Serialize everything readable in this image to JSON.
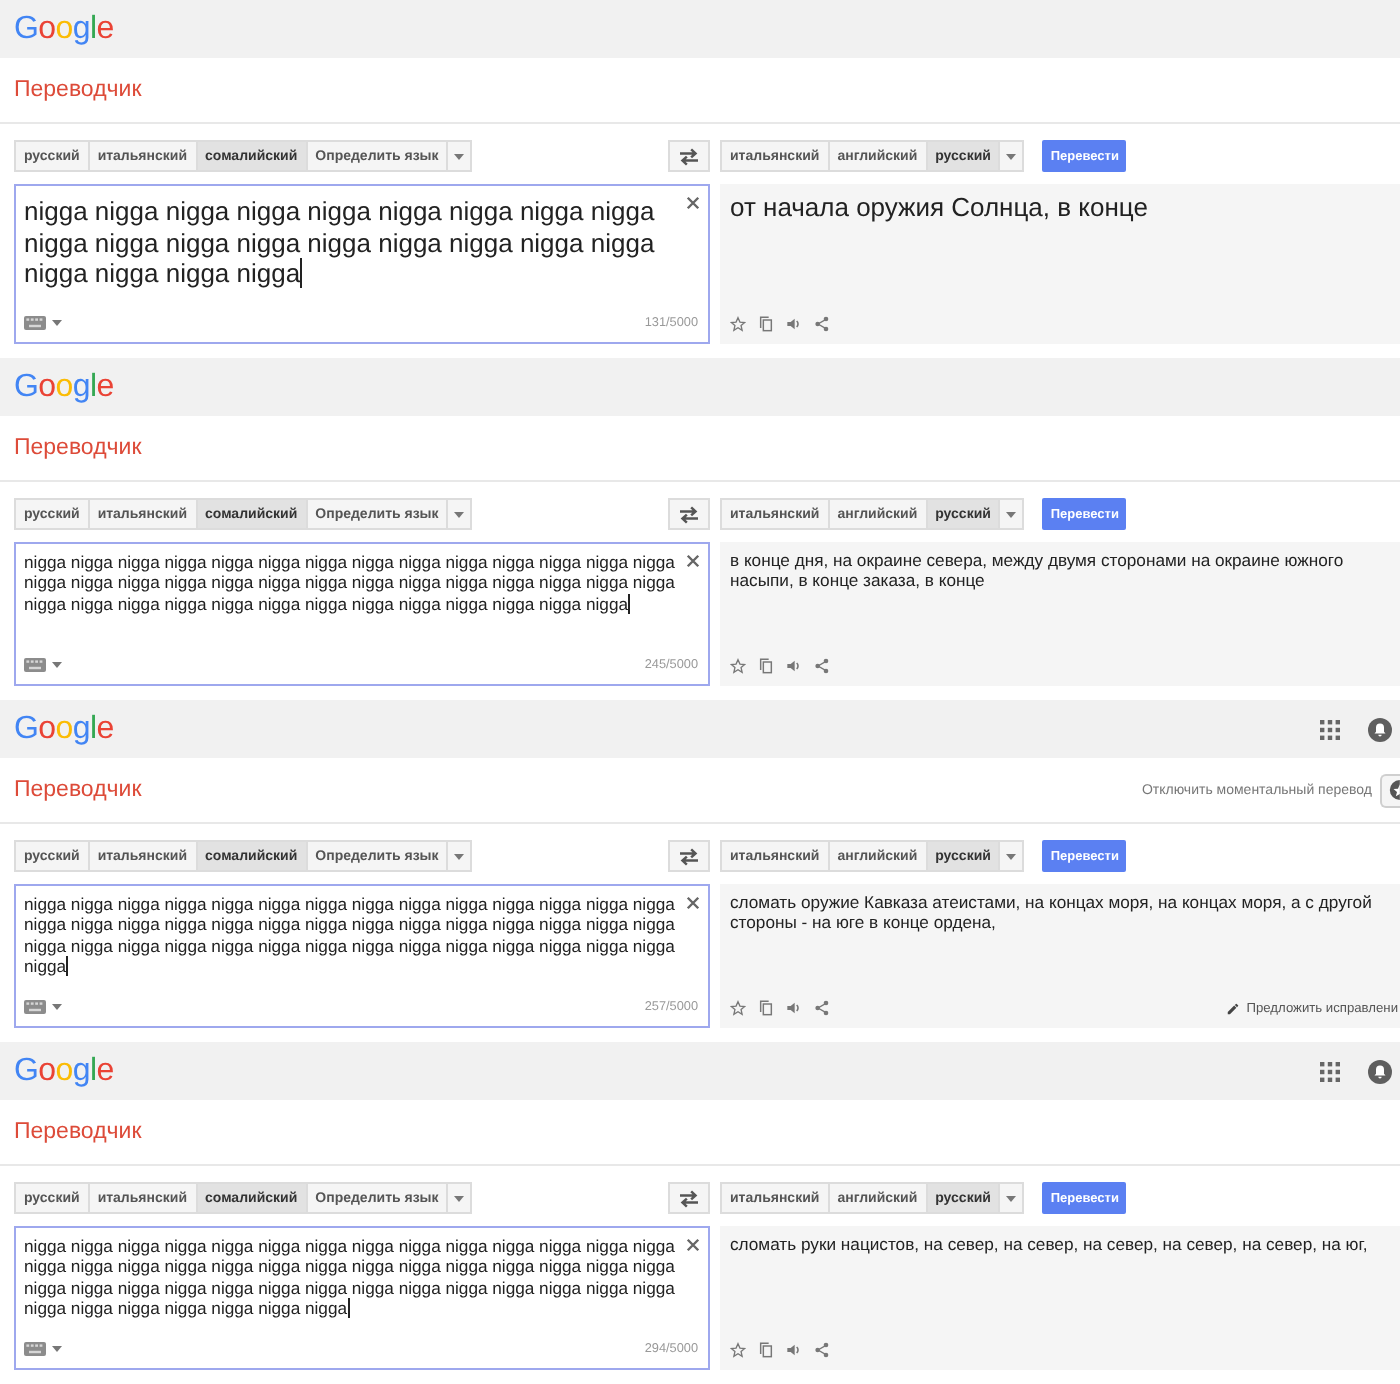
{
  "panels": [
    {
      "logo": "Google",
      "title": "Переводчик",
      "source_languages": [
        {
          "label": "русский",
          "selected": false
        },
        {
          "label": "итальянский",
          "selected": false
        },
        {
          "label": "сомалийский",
          "selected": true
        },
        {
          "label": "Определить язык",
          "selected": false
        }
      ],
      "target_languages": [
        {
          "label": "итальянский",
          "selected": false
        },
        {
          "label": "английский",
          "selected": false
        },
        {
          "label": "русский",
          "selected": true
        }
      ],
      "translate_button": "Перевести",
      "focused": true,
      "source_text": "nigga nigga nigga nigga nigga nigga nigga nigga nigga nigga nigga nigga nigga nigga nigga nigga nigga nigga nigga nigga nigga nigga",
      "char_count": "131/5000",
      "translation": "от начала оружия Солнца, в конце"
    },
    {
      "logo": "Google",
      "title": "Переводчик",
      "source_languages": [
        {
          "label": "русский",
          "selected": false
        },
        {
          "label": "итальянский",
          "selected": false
        },
        {
          "label": "сомалийский",
          "selected": true
        },
        {
          "label": "Определить язык",
          "selected": false
        }
      ],
      "target_languages": [
        {
          "label": "итальянский",
          "selected": false
        },
        {
          "label": "английский",
          "selected": false
        },
        {
          "label": "русский",
          "selected": true
        }
      ],
      "translate_button": "Перевести",
      "focused": true,
      "source_text": "nigga nigga nigga nigga nigga nigga nigga nigga nigga nigga nigga nigga nigga nigga nigga nigga nigga nigga nigga nigga nigga nigga nigga nigga nigga nigga nigga nigga nigga nigga nigga nigga nigga nigga nigga nigga nigga nigga nigga nigga nigga",
      "char_count": "245/5000",
      "translation": "в конце дня, на окраине севера, между двумя сторонами на окраине южного насыпи, в конце заказа, в конце"
    },
    {
      "logo": "Google",
      "header_buttons": [
        {
          "kind": "apps"
        },
        {
          "kind": "notifications"
        }
      ],
      "title": "Переводчик",
      "instant_toggle": "Отключить моментальный перевод",
      "title_buttons": [
        {
          "kind": "star"
        }
      ],
      "source_languages": [
        {
          "label": "русский",
          "selected": false
        },
        {
          "label": "итальянский",
          "selected": false
        },
        {
          "label": "сомалийский",
          "selected": true
        },
        {
          "label": "Определить язык",
          "selected": false
        }
      ],
      "target_languages": [
        {
          "label": "итальянский",
          "selected": false
        },
        {
          "label": "английский",
          "selected": false
        },
        {
          "label": "русский",
          "selected": true
        }
      ],
      "translate_button": "Перевести",
      "focused": true,
      "source_text": "nigga nigga nigga nigga nigga nigga nigga nigga nigga nigga nigga nigga nigga nigga nigga nigga nigga nigga nigga nigga nigga nigga nigga nigga nigga nigga nigga nigga nigga nigga nigga nigga nigga nigga nigga nigga nigga nigga nigga nigga nigga nigga nigga",
      "char_count": "257/5000",
      "translation": "сломать оружие Кавказа атеистами, на концах моря, на концах моря, а с другой стороны - на юге в конце ордена,",
      "suggest_edit": "Предложить исправлени"
    },
    {
      "logo": "Google",
      "header_buttons": [
        {
          "kind": "apps"
        },
        {
          "kind": "notifications"
        }
      ],
      "title": "Переводчик",
      "source_languages": [
        {
          "label": "русский",
          "selected": false
        },
        {
          "label": "итальянский",
          "selected": false
        },
        {
          "label": "сомалийский",
          "selected": true
        },
        {
          "label": "Определить язык",
          "selected": false
        }
      ],
      "target_languages": [
        {
          "label": "итальянский",
          "selected": false
        },
        {
          "label": "английский",
          "selected": false
        },
        {
          "label": "русский",
          "selected": true
        }
      ],
      "translate_button": "Перевести",
      "focused": true,
      "source_text": "nigga nigga nigga nigga nigga nigga nigga nigga nigga nigga nigga nigga nigga nigga nigga nigga nigga nigga nigga nigga nigga nigga nigga nigga nigga nigga nigga nigga nigga nigga nigga nigga nigga nigga nigga nigga nigga nigga nigga nigga nigga nigga nigga nigga nigga nigga nigga nigga nigga",
      "char_count": "294/5000",
      "translation": "сломать руки нацистов, на север, на север, на север, на север, на север, на юг,"
    }
  ]
}
